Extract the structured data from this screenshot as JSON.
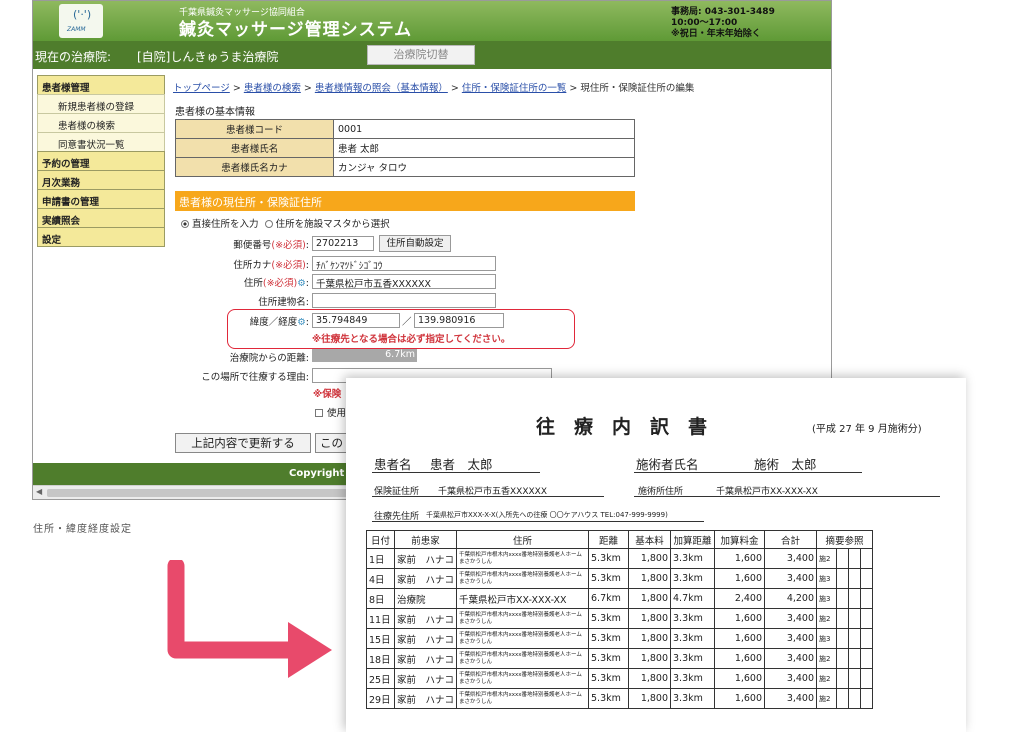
{
  "header": {
    "logo_text": "ZAMM",
    "org_name": "千葉県鍼灸マッサージ協同組合",
    "system_name": "鍼灸マッサージ管理システム",
    "contact": [
      "事務局: 043-301-3489",
      "10:00〜17:00",
      "※祝日・年末年始除く"
    ]
  },
  "status_bar": {
    "label": "現在の治療院:",
    "clinic": "[自院]しんきゅうま治療院",
    "switch_button": "治療院切替"
  },
  "sidebar": {
    "items": [
      {
        "label": "患者様管理",
        "level": 1
      },
      {
        "label": "新規患者様の登録",
        "level": 2
      },
      {
        "label": "患者様の検索",
        "level": 2
      },
      {
        "label": "同意書状況一覧",
        "level": 2
      },
      {
        "label": "予約の管理",
        "level": 1
      },
      {
        "label": "月次業務",
        "level": 1
      },
      {
        "label": "申請書の管理",
        "level": 1
      },
      {
        "label": "実績照会",
        "level": 1
      },
      {
        "label": "設定",
        "level": 1
      }
    ]
  },
  "breadcrumb": {
    "links": [
      "トップページ",
      "患者様の検索",
      "患者様情報の照会（基本情報）",
      "住所・保険証住所の一覧"
    ],
    "separator": " > ",
    "current": "現住所・保険証住所の編集"
  },
  "patient": {
    "section_title": "患者様の基本情報",
    "rows": [
      {
        "label": "患者様コード",
        "value": "0001"
      },
      {
        "label": "患者様氏名",
        "value": "患者 太郎"
      },
      {
        "label": "患者様氏名カナ",
        "value": "カンジャ タロウ"
      }
    ]
  },
  "address_form": {
    "banner": "患者様の現住所・保険証住所",
    "radio_direct": "直接住所を入力",
    "radio_master": "住所を施設マスタから選択",
    "zip_label": "郵便番号",
    "required_mark": "(※必須)",
    "colon": ":",
    "zip_value": "2702213",
    "auto_button": "住所自動設定",
    "kana_label": "住所カナ",
    "kana_value": "ﾁﾊﾞｹﾝﾏﾂﾄﾞｼｺﾞｺｳ",
    "address_label": "住所",
    "address_value": "千葉県松戸市五香XXXXXX",
    "building_label": "住所建物名:",
    "latlng_label": "緯度／経度",
    "lat_value": "35.794849",
    "slash": "／",
    "lng_value": "139.980916",
    "latlng_note": "※往療先となる場合は必ず指定してください。",
    "distance_label": "治療院からの距離:",
    "distance_value": "6.7km",
    "reason_label": "この場所で往療する理由:",
    "partial_note": "※保険",
    "partial_check": "使用",
    "update_button": "上記内容で更新する",
    "update_button2": "この"
  },
  "footer": {
    "copyright": "Copyright ("
  },
  "caption": "住所・緯度経度設定",
  "statement": {
    "title": "往療内訳書",
    "period": "(平成 27 年 9 月施術分)",
    "patient_label": "患者名",
    "patient_name": "患者　太郎",
    "therapist_label": "施術者氏名",
    "therapist_name": "施術　太郎",
    "insurance_label": "保険証住所",
    "insurance_address": "千葉県松戸市五香XXXXXX",
    "clinic_label": "施術所住所",
    "clinic_address": "千葉県松戸市XX-XXX-XX",
    "visit_label": "往療先住所",
    "visit_address": "千葉県松戸市XXX-X-X(入所先への往療 〇〇ケアハウス TEL:047-999-9999)",
    "columns": [
      "日付",
      "前患家",
      "住所",
      "距離",
      "基本料",
      "加算距離",
      "加算料金",
      "合計",
      "摘要参照"
    ],
    "rows": [
      {
        "date": "1日",
        "prev": "家前　ハナコ",
        "addr": "千葉県松戸市根木内xxxx番地特別養護老人ホームまさかうしん",
        "dist": "5.3km",
        "base": "1,800",
        "extra_dist": "3.3km",
        "extra_fee": "1,600",
        "total": "3,400",
        "note": "施2"
      },
      {
        "date": "4日",
        "prev": "家前　ハナコ",
        "addr": "千葉県松戸市根木内xxxx番地特別養護老人ホームまさかうしん",
        "dist": "5.3km",
        "base": "1,800",
        "extra_dist": "3.3km",
        "extra_fee": "1,600",
        "total": "3,400",
        "note": "施3"
      },
      {
        "date": "8日",
        "prev": "治療院",
        "addr": "千葉県松戸市XX-XXX-XX",
        "dist": "6.7km",
        "base": "1,800",
        "extra_dist": "4.7km",
        "extra_fee": "2,400",
        "total": "4,200",
        "note": "施3"
      },
      {
        "date": "11日",
        "prev": "家前　ハナコ",
        "addr": "千葉県松戸市根木内xxxx番地特別養護老人ホームまさかうしん",
        "dist": "5.3km",
        "base": "1,800",
        "extra_dist": "3.3km",
        "extra_fee": "1,600",
        "total": "3,400",
        "note": "施2"
      },
      {
        "date": "15日",
        "prev": "家前　ハナコ",
        "addr": "千葉県松戸市根木内xxxx番地特別養護老人ホームまさかうしん",
        "dist": "5.3km",
        "base": "1,800",
        "extra_dist": "3.3km",
        "extra_fee": "1,600",
        "total": "3,400",
        "note": "施3"
      },
      {
        "date": "18日",
        "prev": "家前　ハナコ",
        "addr": "千葉県松戸市根木内xxxx番地特別養護老人ホームまさかうしん",
        "dist": "5.3km",
        "base": "1,800",
        "extra_dist": "3.3km",
        "extra_fee": "1,600",
        "total": "3,400",
        "note": "施2"
      },
      {
        "date": "25日",
        "prev": "家前　ハナコ",
        "addr": "千葉県松戸市根木内xxxx番地特別養護老人ホームまさかうしん",
        "dist": "5.3km",
        "base": "1,800",
        "extra_dist": "3.3km",
        "extra_fee": "1,600",
        "total": "3,400",
        "note": "施2"
      },
      {
        "date": "29日",
        "prev": "家前　ハナコ",
        "addr": "千葉県松戸市根木内xxxx番地特別養護老人ホームまさかうしん",
        "dist": "5.3km",
        "base": "1,800",
        "extra_dist": "3.3km",
        "extra_fee": "1,600",
        "total": "3,400",
        "note": "施2"
      }
    ]
  },
  "colors": {
    "header_green": "#5f9a36",
    "bar_green": "#4f7d2c",
    "banner_orange": "#f7a71b",
    "menu_yellow": "#f4e99a",
    "required_red": "#d0343c",
    "arrow_pink": "#e84a6b"
  },
  "icons": {
    "map_pin": "map-pin-icon",
    "arrow": "arrow-icon"
  }
}
